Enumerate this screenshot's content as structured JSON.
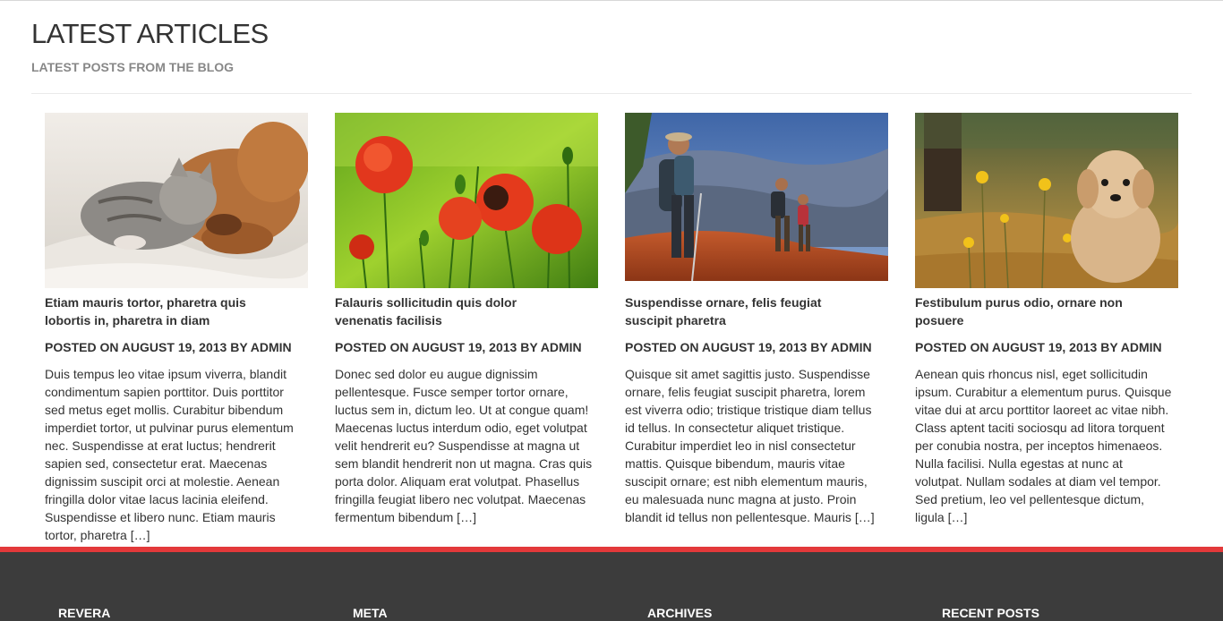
{
  "section": {
    "title": "LATEST ARTICLES",
    "subtitle": "LATEST POSTS FROM THE BLOG"
  },
  "articles": [
    {
      "image": "kitten-and-puppy-sleeping-photo",
      "title": "Etiam mauris tortor, pharetra quis lobortis in, pharetra in diam",
      "meta": "POSTED ON AUGUST 19, 2013 BY ADMIN",
      "excerpt": "Duis tempus leo vitae ipsum viverra, blandit condimentum sapien porttitor. Duis porttitor sed metus eget mollis. Curabitur bibendum imperdiet tortor, ut pulvinar purus elementum nec. Suspendisse at erat luctus; hendrerit sapien sed, consectetur erat. Maecenas dignissim suscipit orci at molestie. Aenean fringilla dolor vitae lacus lacinia eleifend. Suspendisse et libero nunc. Etiam mauris tortor, pharetra […]"
    },
    {
      "image": "red-poppies-photo",
      "title": "Falauris sollicitudin quis dolor venenatis facilisis",
      "meta": "POSTED ON AUGUST 19, 2013 BY ADMIN",
      "excerpt": "Donec sed dolor eu augue dignissim pellentesque. Fusce semper tortor ornare, luctus sem in, dictum leo. Ut at congue quam! Maecenas luctus interdum odio, eget volutpat velit hendrerit eu? Suspendisse at magna ut sem blandit hendrerit non ut magna. Cras quis porta dolor. Aliquam erat volutpat. Phasellus fringilla feugiat libero nec volutpat. Maecenas fermentum bibendum […]"
    },
    {
      "image": "hikers-canyon-photo",
      "title": "Suspendisse ornare, felis feugiat suscipit pharetra",
      "meta": "POSTED ON AUGUST 19, 2013 BY ADMIN",
      "excerpt": "Quisque sit amet sagittis justo. Suspendisse ornare, felis feugiat suscipit pharetra, lorem est viverra odio; tristique tristique diam tellus id tellus. In consectetur aliquet tristique. Curabitur imperdiet leo in nisl consectetur mattis. Quisque bibendum, mauris vitae suscipit ornare; est nibh elementum mauris, eu malesuada nunc magna at justo. Proin blandit id tellus non pellentesque. Mauris […]"
    },
    {
      "image": "puppy-in-field-photo",
      "title": "Festibulum purus odio, ornare non posuere",
      "meta": "POSTED ON AUGUST 19, 2013 BY ADMIN",
      "excerpt": "Aenean quis rhoncus nisl, eget sollicitudin ipsum. Curabitur a elementum purus. Quisque vitae dui at arcu porttitor laoreet ac vitae nibh. Class aptent taciti sociosqu ad litora torquent per conubia nostra, per inceptos himenaeos. Nulla facilisi. Nulla egestas at nunc at volutpat. Nullam sodales at diam vel tempor. Sed pretium, leo vel pellentesque dictum, ligula […]"
    }
  ],
  "footer": {
    "headings": [
      "REVERA",
      "META",
      "ARCHIVES",
      "RECENT POSTS"
    ]
  },
  "colors": {
    "accent": "#e3393a",
    "footer_bg": "#3c3c3c"
  }
}
